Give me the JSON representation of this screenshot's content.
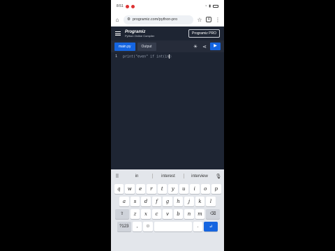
{
  "status": {
    "time": "8:51",
    "battery_icon": "battery-icon"
  },
  "browser": {
    "url": "programiz.com/python-pro"
  },
  "app": {
    "brand": "Programiz",
    "subtitle": "Python Online Compiler",
    "pro_label": "Programiz PRO"
  },
  "editor": {
    "tabs": [
      {
        "label": "main.py"
      },
      {
        "label": "Output"
      }
    ],
    "lines": [
      {
        "number": "1",
        "code": "print(\"even\" if int(in",
        "code_after": ")"
      }
    ]
  },
  "keyboard": {
    "suggestions": [
      "in",
      "interest",
      "interview"
    ],
    "rows": [
      [
        "q",
        "w",
        "e",
        "r",
        "t",
        "y",
        "u",
        "i",
        "o",
        "p"
      ],
      [
        "a",
        "s",
        "d",
        "f",
        "g",
        "h",
        "j",
        "k",
        "l"
      ],
      [
        "z",
        "x",
        "c",
        "v",
        "b",
        "n",
        "m"
      ]
    ],
    "symbols_label": "?123",
    "comma": ",",
    "period": "."
  },
  "colors": {
    "accent": "#1565e0",
    "header_bg": "#1e2533",
    "toolbar_bg": "#262c3a"
  }
}
